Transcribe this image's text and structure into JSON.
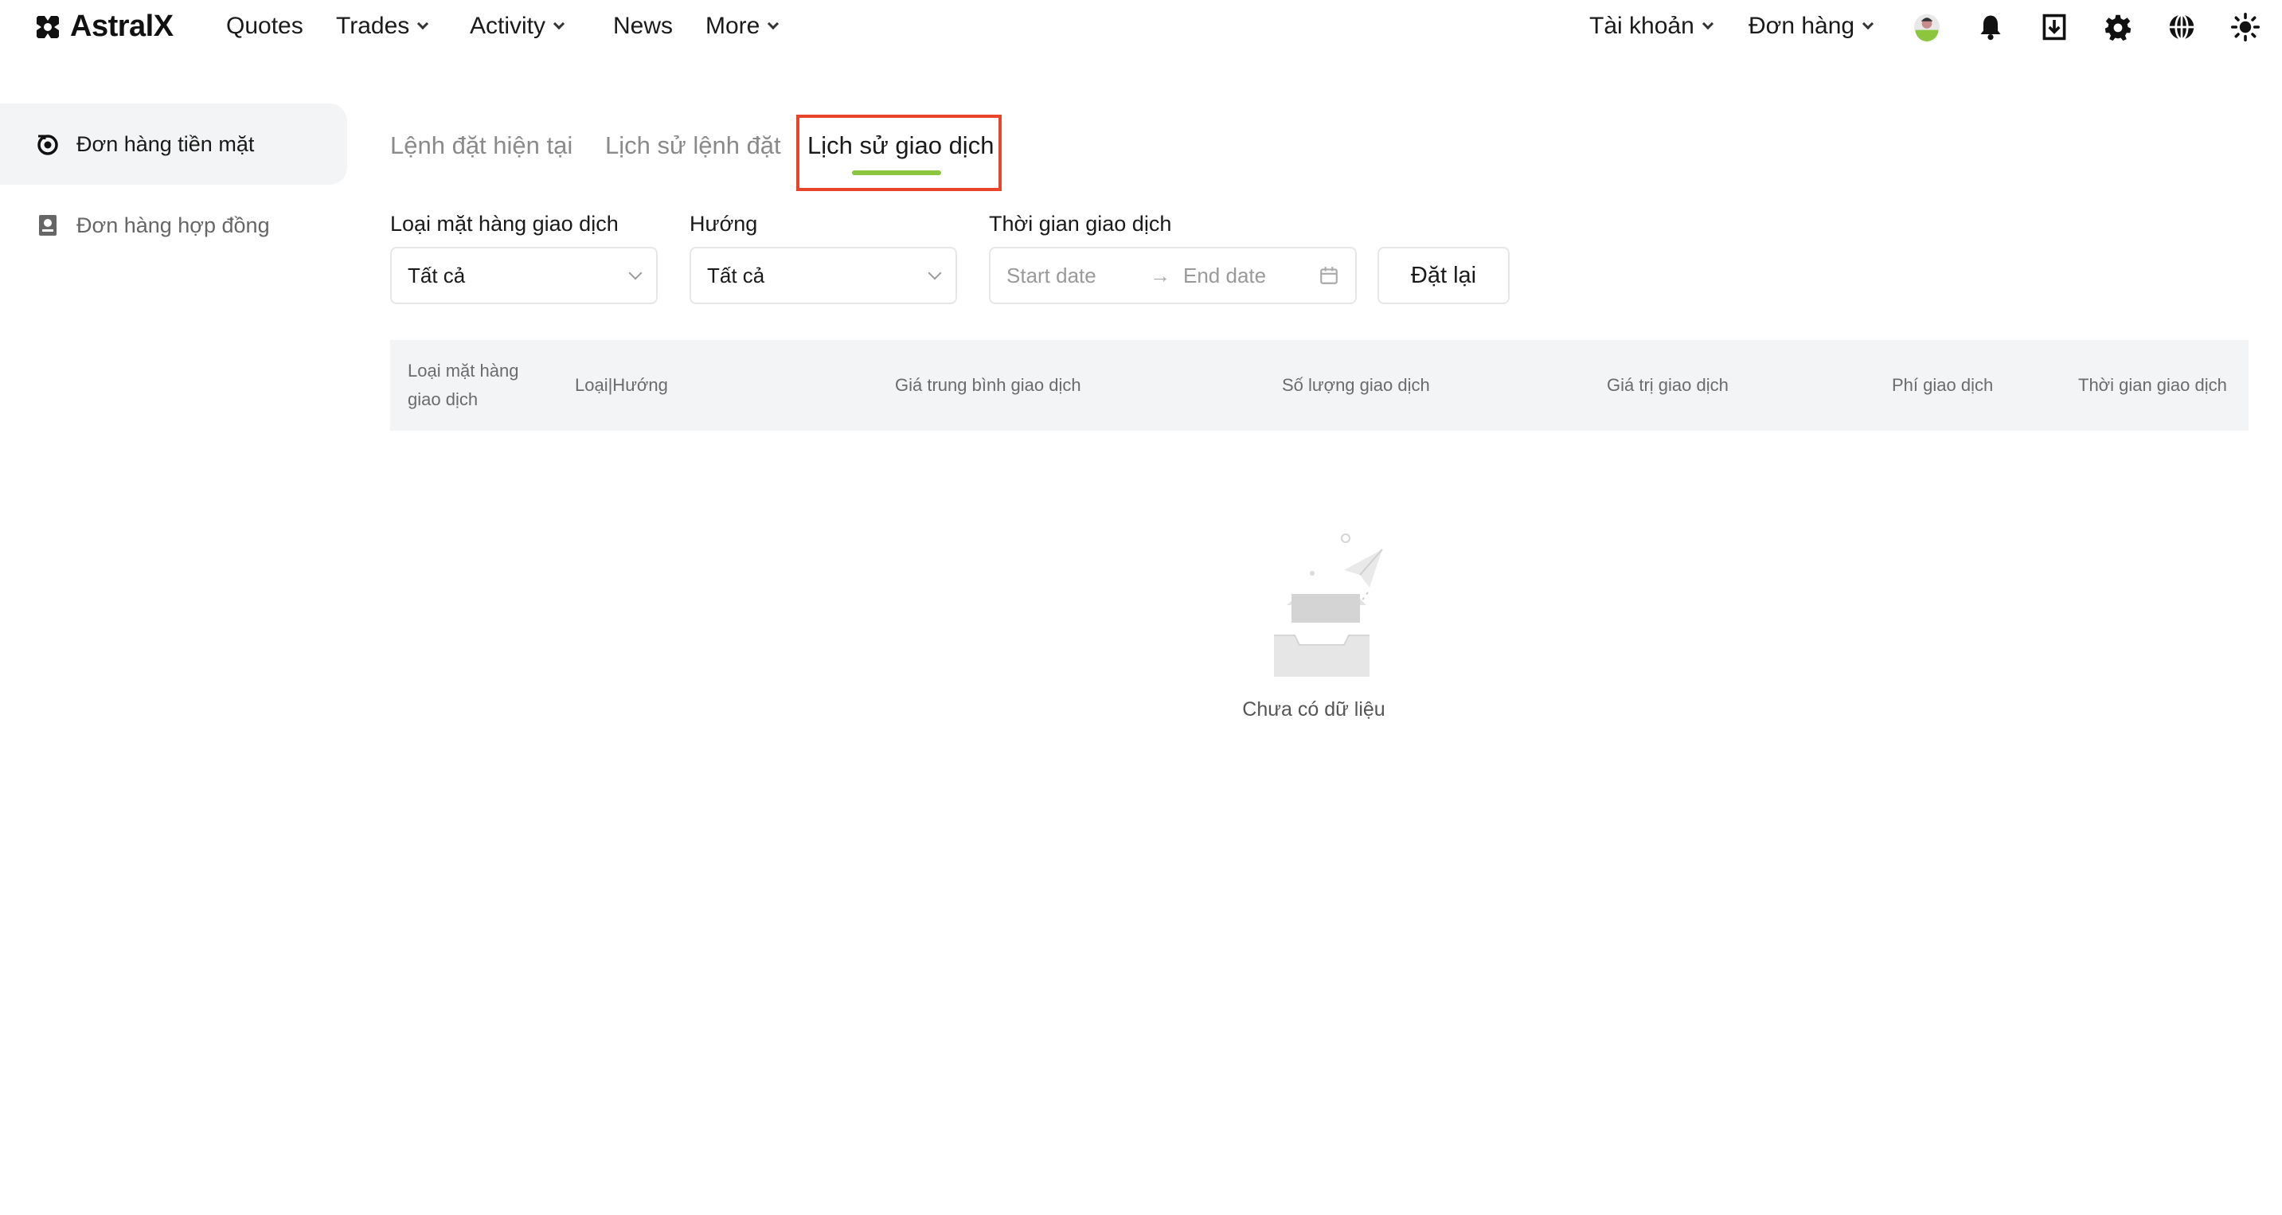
{
  "brand": {
    "name": "AstralX"
  },
  "nav": {
    "quotes": "Quotes",
    "trades": "Trades",
    "activity": "Activity",
    "news": "News",
    "more": "More",
    "account": "Tài khoản",
    "orders": "Đơn hàng"
  },
  "icons": [
    "avatar",
    "bell-icon",
    "download-icon",
    "gear-icon",
    "globe-icon",
    "theme-icon"
  ],
  "sidebar": {
    "items": [
      {
        "label": "Đơn hàng tiền mặt",
        "active": true
      },
      {
        "label": "Đơn hàng hợp đồng",
        "active": false
      }
    ]
  },
  "tabs": [
    {
      "label": "Lệnh đặt hiện tại"
    },
    {
      "label": "Lịch sử lệnh đặt"
    },
    {
      "label": "Lịch sử giao dịch",
      "active": true
    }
  ],
  "filters": {
    "type_label": "Loại mặt hàng giao dịch",
    "type_value": "Tất cả",
    "direction_label": "Hướng",
    "direction_value": "Tất cả",
    "time_label": "Thời gian giao dịch",
    "start_placeholder": "Start date",
    "end_placeholder": "End date",
    "reset": "Đặt lại"
  },
  "table": {
    "columns": [
      "Loại mặt hàng giao dịch",
      "Loại|Hướng",
      "Giá trung bình giao dịch",
      "Số lượng giao dịch",
      "Giá trị giao dịch",
      "Phí giao dịch",
      "Thời gian giao dịch"
    ]
  },
  "empty_state": {
    "text": "Chưa có dữ liệu"
  },
  "colors": {
    "accent": "#8cc63f",
    "highlight": "#e8452c",
    "header_bg": "#f3f4f5"
  }
}
